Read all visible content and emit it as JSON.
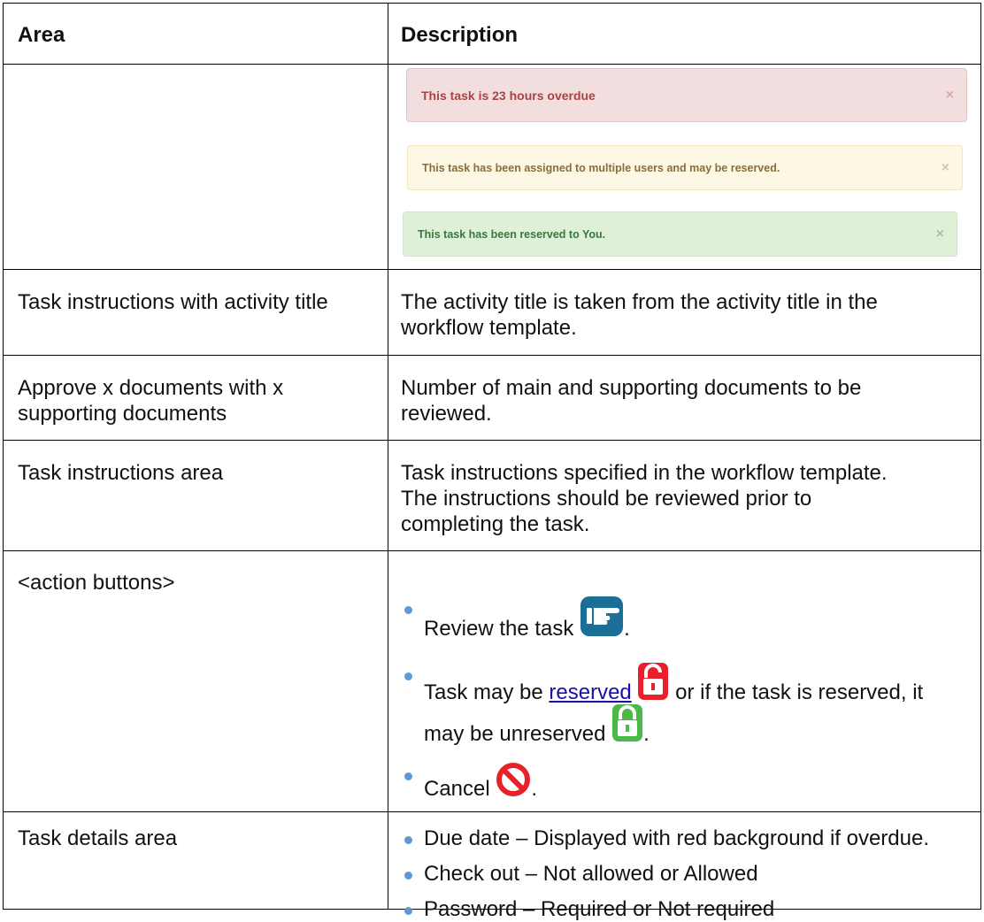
{
  "headers": {
    "area": "Area",
    "description": "Description"
  },
  "alerts": {
    "overdue": "This task is 23 hours overdue",
    "multiple": "This task has been assigned to multiple users and may be reserved.",
    "reserved": "This task has been reserved to You.",
    "close_glyph": "×"
  },
  "rows": {
    "task_instructions_title": {
      "area": "Task instructions with activity title",
      "description_l1": "The activity title is taken from the activity title in the",
      "description_l2": "workflow template."
    },
    "approve_docs": {
      "area_l1": "Approve x documents with x",
      "area_l2": "supporting documents",
      "description_l1": "Number of main and supporting documents to be",
      "description_l2": "reviewed."
    },
    "instructions_area": {
      "area": "Task instructions area",
      "description_l1": "Task instructions specified in the workflow template.",
      "description_l2": "The instructions should be reviewed prior to",
      "description_l3": "completing the task."
    },
    "action_buttons": {
      "area": "<action buttons>",
      "review": "Review the task",
      "reserve_pre": "Task may be",
      "reserve_link": "reserved",
      "reserve_post": "or if the task is reserved, it",
      "unreserve": "may be unreserved",
      "cancel": "Cancel",
      "period": "."
    },
    "task_details": {
      "area": "Task details area",
      "due_date": "Due date – Displayed with red background if overdue.",
      "check_out": "Check out – Not allowed or Allowed",
      "password": "Password – Required or Not required"
    }
  },
  "colors": {
    "review_icon": "#1b6e95",
    "reserve_icon": "#e8202a",
    "unreserve_icon": "#4cb848",
    "cancel_icon": "#e8202a",
    "bullet": "#5b9bd5"
  },
  "icons": [
    "pointing-hand-icon",
    "unlocked-padlock-icon",
    "locked-padlock-icon",
    "prohibited-icon"
  ]
}
